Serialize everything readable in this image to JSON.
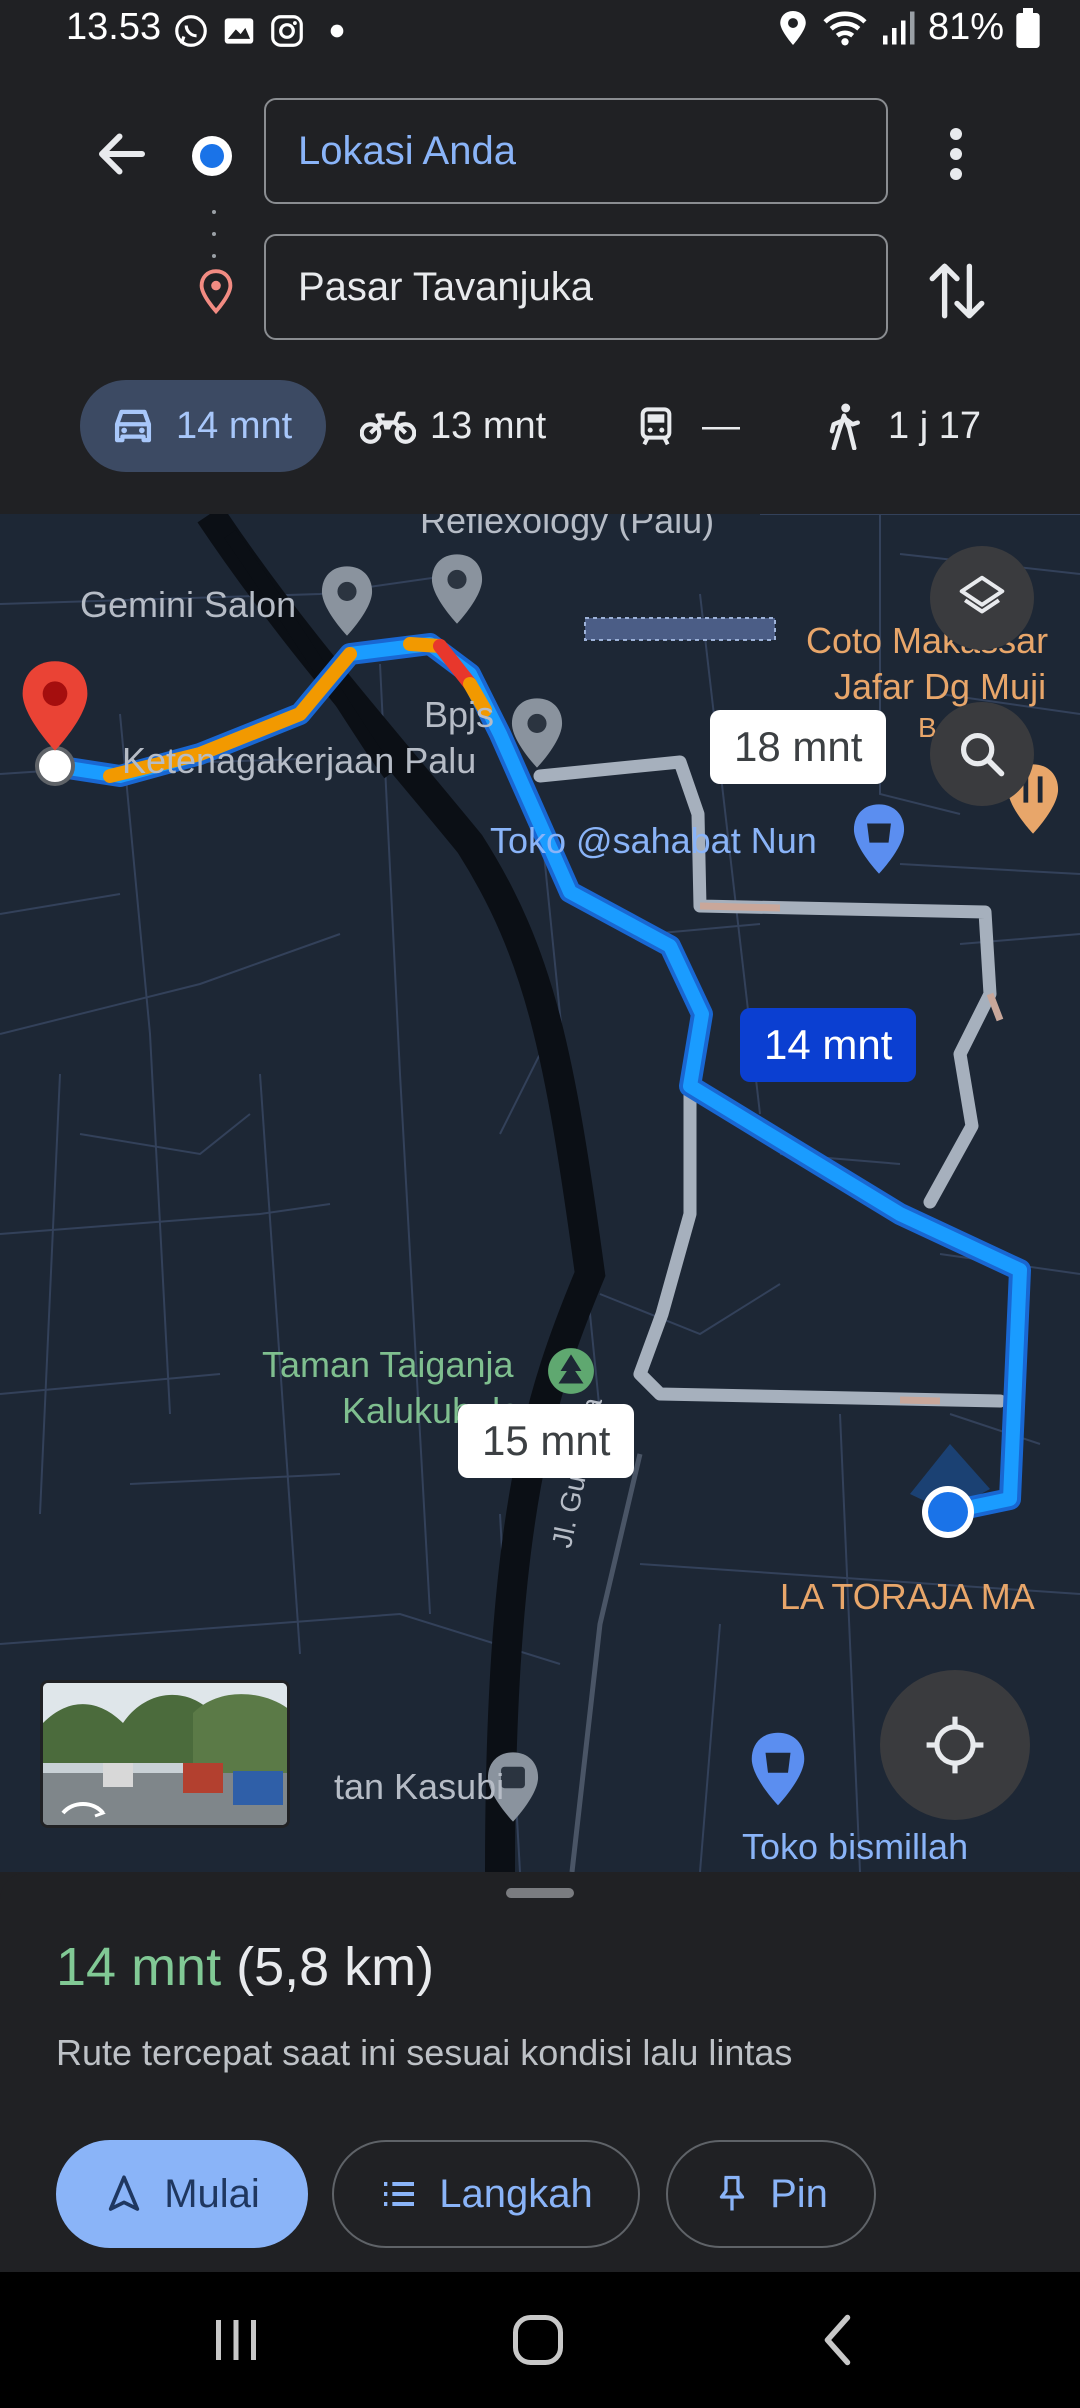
{
  "status_bar": {
    "time": "13.53",
    "notification_icons": [
      "whatsapp-icon",
      "gallery-icon",
      "instagram-icon",
      "dot-icon"
    ],
    "system_icons": [
      "location-icon",
      "wifi-icon",
      "signal-icon",
      "battery-icon"
    ],
    "battery": "81%"
  },
  "route": {
    "origin": "Lokasi Anda",
    "destination": "Pasar Tavanjuka"
  },
  "travel_modes": [
    {
      "mode": "car",
      "label": "14 mnt",
      "selected": true
    },
    {
      "mode": "motorcycle",
      "label": "13 mnt",
      "selected": false
    },
    {
      "mode": "transit",
      "label": "—",
      "selected": false
    },
    {
      "mode": "walk",
      "label": "1 j 17",
      "selected": false
    }
  ],
  "map": {
    "places": {
      "reflexology": "Reflexology (Palu)",
      "gemini": "Gemini Salon",
      "bpjs1": "Bpjs",
      "bpjs2": "Ketenagakerjaan Palu",
      "toko_sahabat": "Toko @sahabat Nun",
      "coto1": "Coto Makassar",
      "coto2": "Jafar Dg Muji",
      "bat": "B",
      "taman1": "Taman Taiganja",
      "taman2": "Kalukubula",
      "street": "Jl. Guru Tua",
      "la_toraja": "LA TORAJA MA",
      "kasubi": "tan Kasubi",
      "toko_bismillah": "Toko bismillah"
    },
    "callouts": {
      "primary": "14 mnt",
      "alt1": "18 mnt",
      "alt2": "15 mnt"
    },
    "colors": {
      "route_primary": "#1a9cff",
      "route_alt": "#a6b0bd",
      "traffic_slow": "#f29900",
      "traffic_jam": "#e8372c",
      "map_bg": "#1d2735"
    }
  },
  "sheet": {
    "duration": "14 mnt",
    "distance": "(5,8 km)",
    "description": "Rute tercepat saat ini sesuai kondisi lalu lintas",
    "start_label": "Mulai",
    "steps_label": "Langkah",
    "pin_label": "Pin"
  }
}
